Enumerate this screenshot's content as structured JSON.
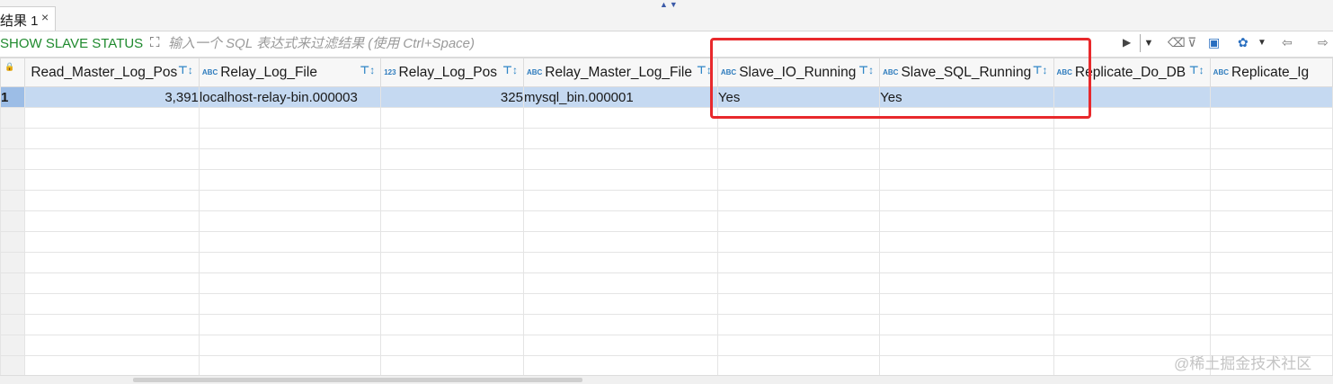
{
  "tab": {
    "label": "结果 1",
    "close": "×"
  },
  "collapse_glyph": "▲▼",
  "filter": {
    "query_label": "SHOW SLAVE STATUS",
    "placeholder": "输入一个 SQL 表达式来过滤结果 (使用 Ctrl+Space)",
    "apply_icon": "▶",
    "history_icon": "▼"
  },
  "toolbar_icons": [
    "eraser-icon",
    "filter-icon",
    "save-filter-icon",
    "config-icon",
    "dropdown-icon",
    "back-icon",
    "forward-icon"
  ],
  "grid": {
    "columns": [
      {
        "name": "Read_Master_Log_Pos",
        "type": ""
      },
      {
        "name": "Relay_Log_File",
        "type": "ABC"
      },
      {
        "name": "Relay_Log_Pos",
        "type": "123"
      },
      {
        "name": "Relay_Master_Log_File",
        "type": "ABC"
      },
      {
        "name": "Slave_IO_Running",
        "type": "ABC"
      },
      {
        "name": "Slave_SQL_Running",
        "type": "ABC"
      },
      {
        "name": "Replicate_Do_DB",
        "type": "ABC"
      },
      {
        "name": "Replicate_Ig",
        "type": "ABC"
      }
    ],
    "rows": [
      {
        "num": "1",
        "cells": [
          "3,391",
          "localhost-relay-bin.000003",
          "325",
          "mysql_bin.000001",
          "Yes",
          "Yes",
          "",
          ""
        ]
      }
    ],
    "empty_rows": 13
  },
  "watermark": "@稀土掘金技术社区"
}
